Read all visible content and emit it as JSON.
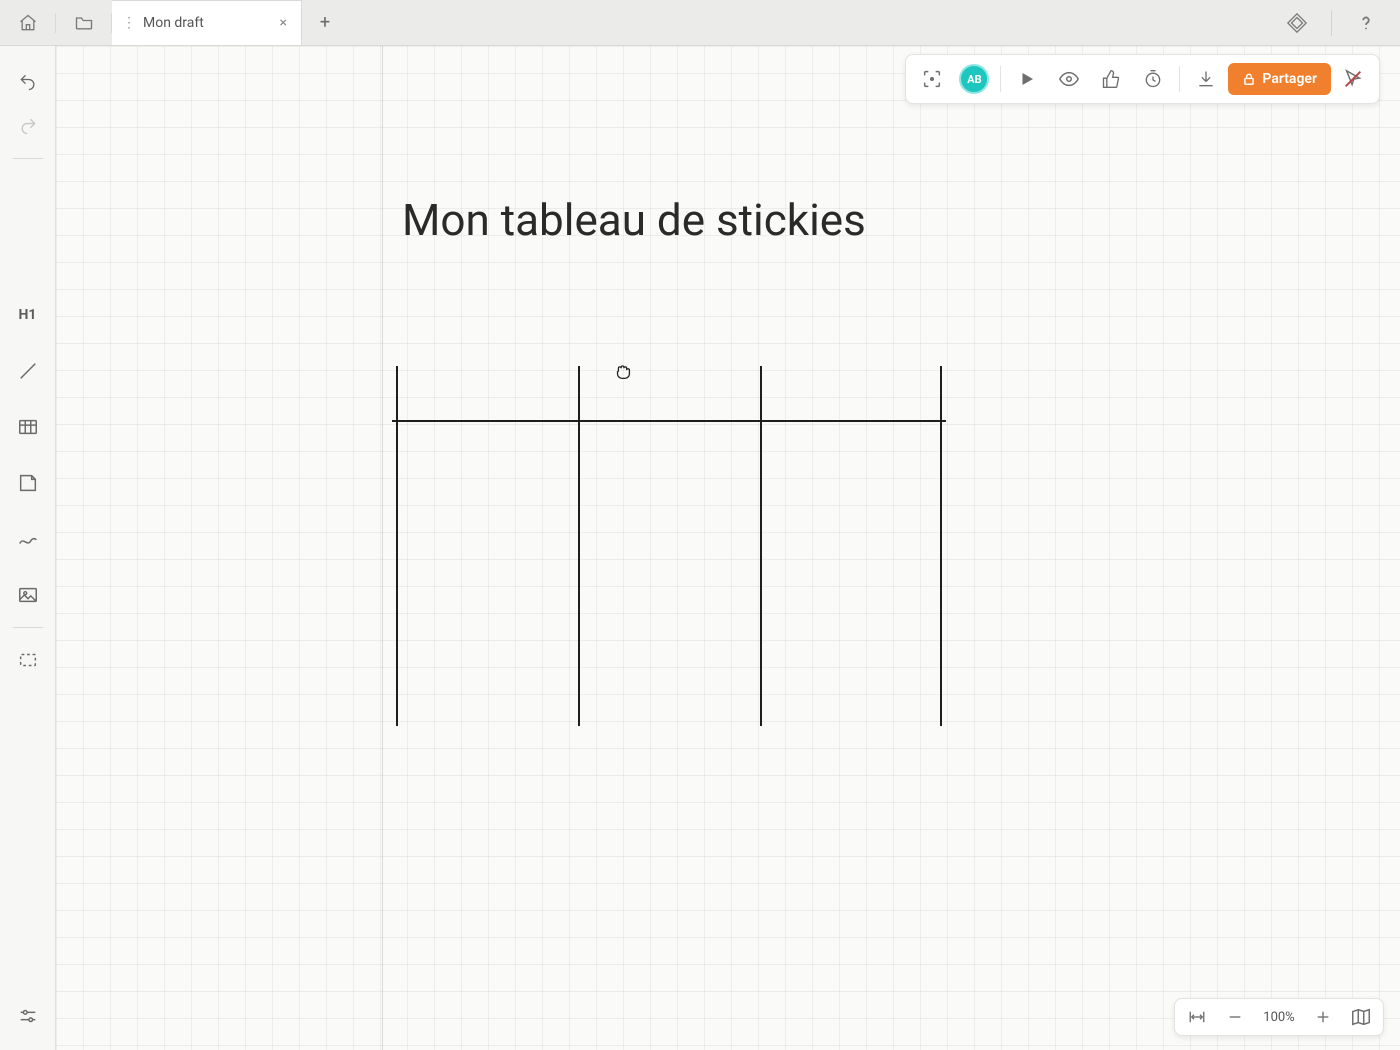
{
  "tab": {
    "title": "Mon draft"
  },
  "avatar": {
    "initials": "AB"
  },
  "share": {
    "label": "Partager"
  },
  "canvas": {
    "heading": "Mon tableau de stickies"
  },
  "zoom": {
    "label": "100%"
  },
  "tools": {
    "h1": "H1"
  }
}
